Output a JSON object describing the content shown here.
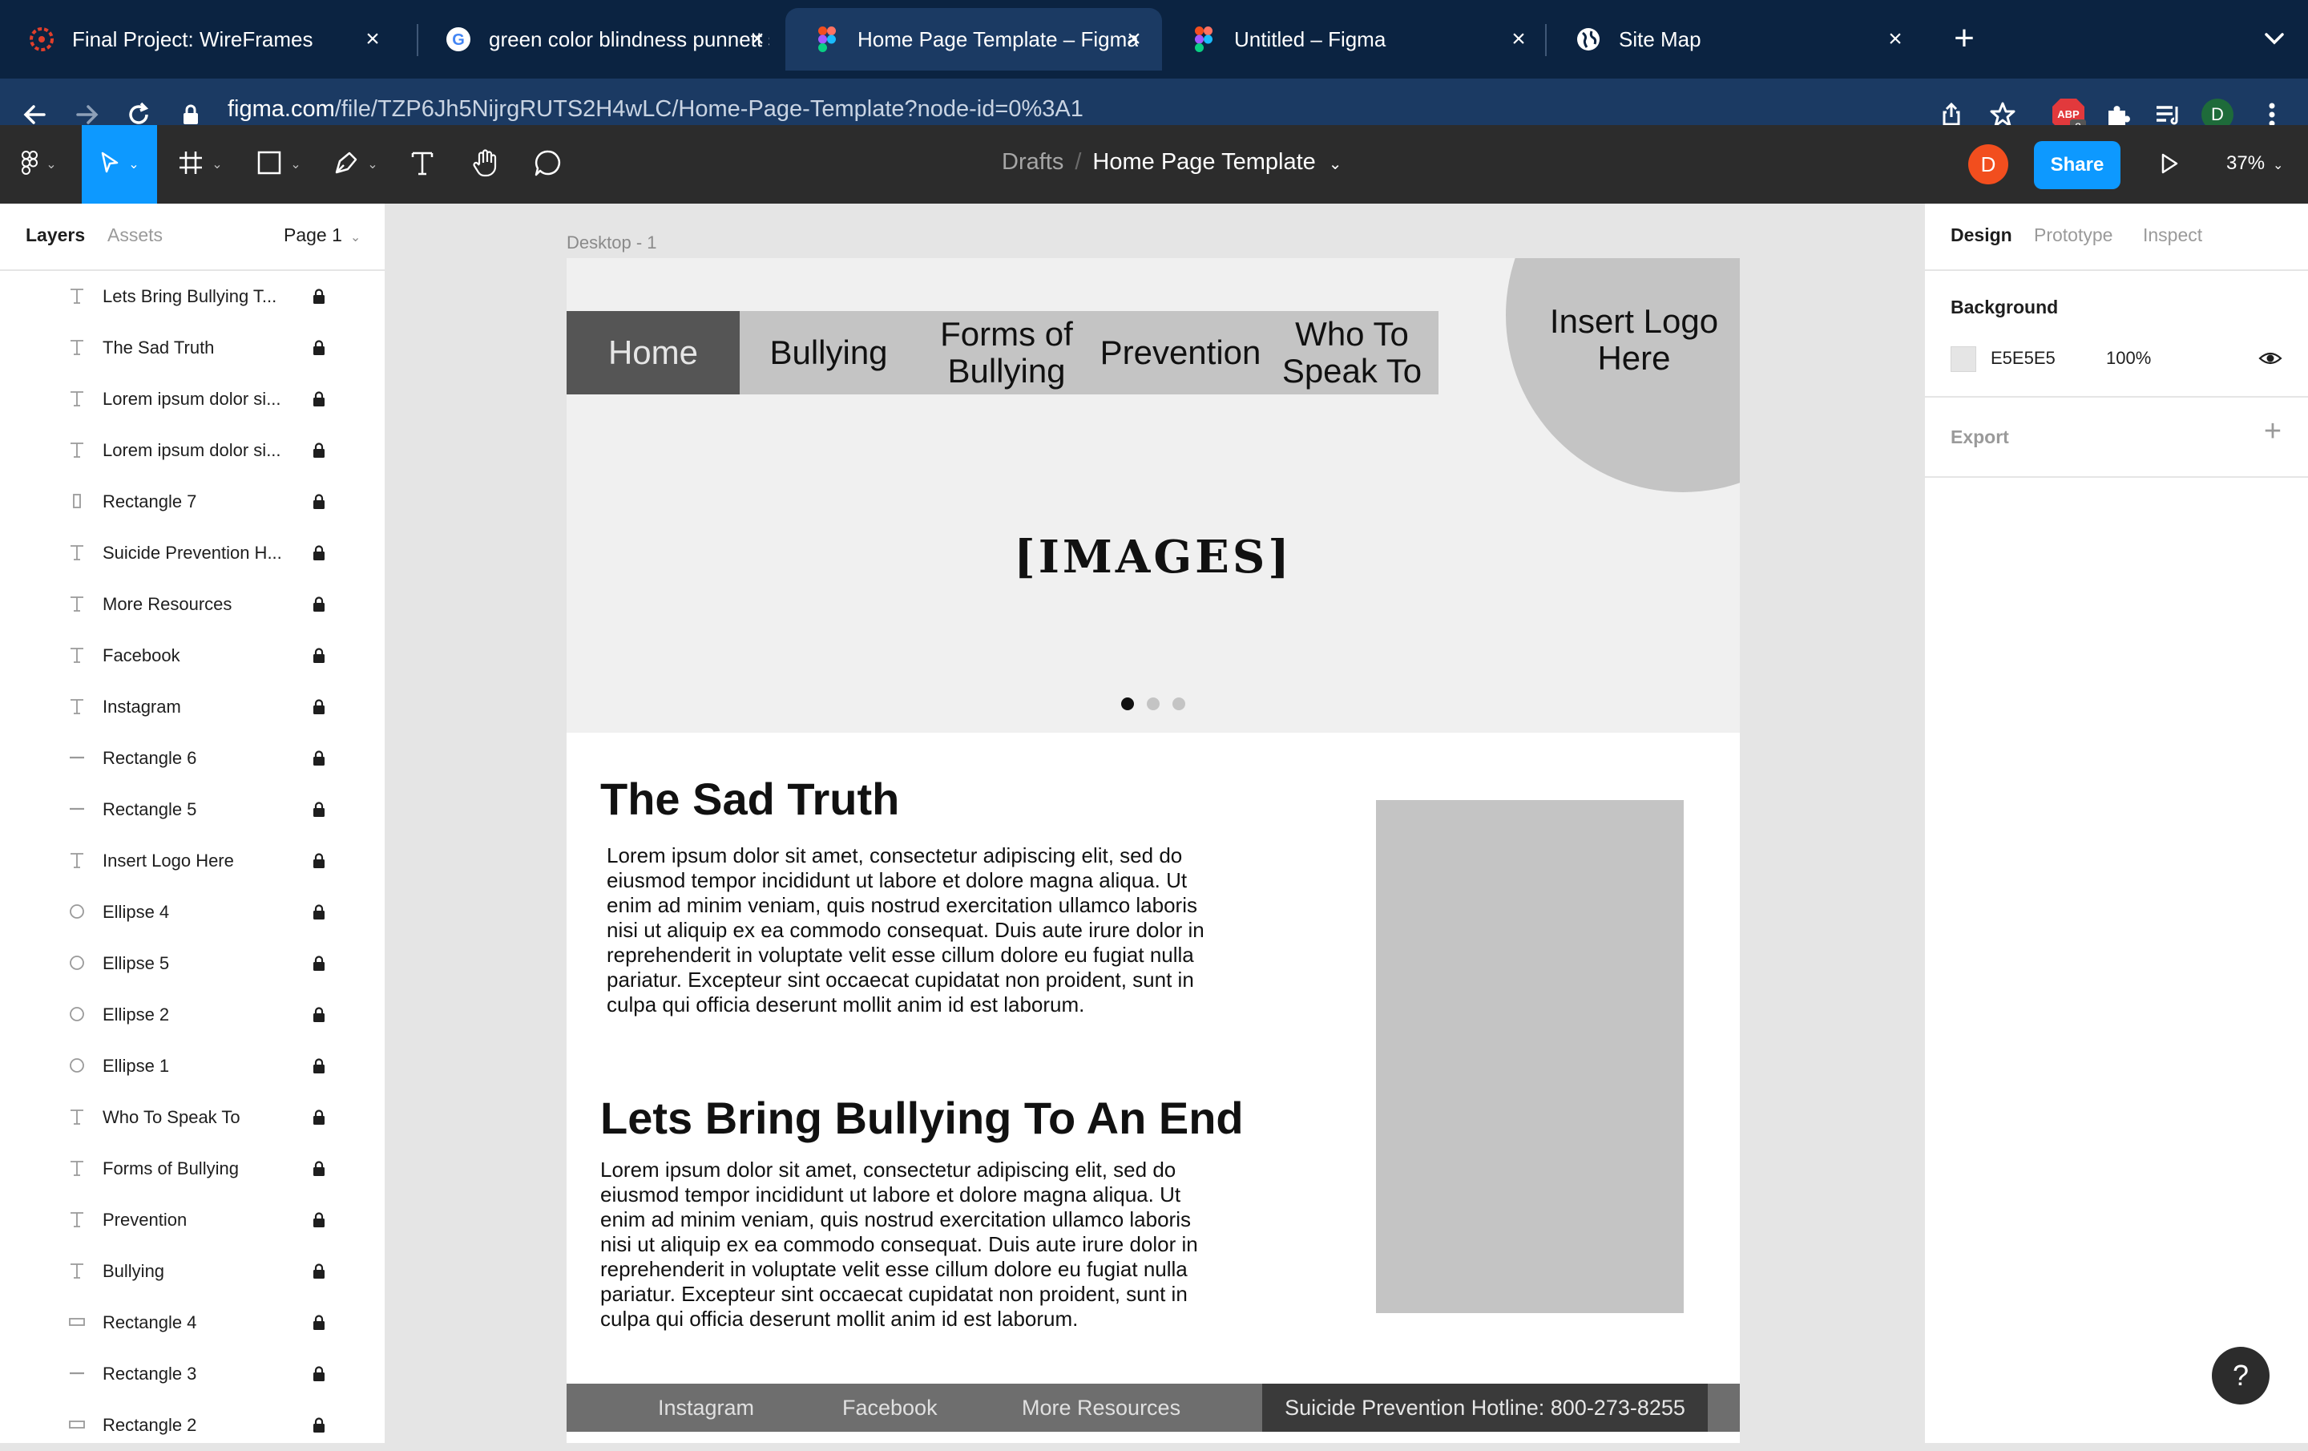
{
  "browser": {
    "tabs": [
      {
        "title": "Final Project: WireFrames",
        "icon": "canvas-icon"
      },
      {
        "title": "green color blindness punnett s",
        "icon": "google-icon"
      },
      {
        "title": "Home Page Template – Figma",
        "icon": "figma-icon",
        "active": true
      },
      {
        "title": "Untitled – Figma",
        "icon": "figma-icon"
      },
      {
        "title": "Site Map",
        "icon": "globe-icon"
      }
    ],
    "url_host": "figma.com",
    "url_path": "/file/TZP6Jh5NijrgRUTS2H4wLC/Home-Page-Template?node-id=0%3A1",
    "abp_badge": "ABP",
    "abp_count": "2",
    "profile_initial": "D"
  },
  "figma": {
    "breadcrumb_parent": "Drafts",
    "breadcrumb_sep": "/",
    "file_name": "Home Page Template",
    "user_initial": "D",
    "share_label": "Share",
    "zoom": "37%"
  },
  "left_panel": {
    "tab_layers": "Layers",
    "tab_assets": "Assets",
    "page": "Page 1",
    "layers": [
      {
        "name": "Lets Bring Bullying T...",
        "type": "text"
      },
      {
        "name": "The Sad Truth",
        "type": "text"
      },
      {
        "name": "Lorem ipsum dolor si...",
        "type": "text"
      },
      {
        "name": "Lorem ipsum dolor si...",
        "type": "text"
      },
      {
        "name": "Rectangle 7",
        "type": "rect-tall"
      },
      {
        "name": "Suicide Prevention H...",
        "type": "text"
      },
      {
        "name": "More Resources",
        "type": "text"
      },
      {
        "name": "Facebook",
        "type": "text"
      },
      {
        "name": "Instagram",
        "type": "text"
      },
      {
        "name": "Rectangle 6",
        "type": "line"
      },
      {
        "name": "Rectangle 5",
        "type": "line"
      },
      {
        "name": "Insert Logo Here",
        "type": "text"
      },
      {
        "name": "Ellipse 4",
        "type": "ellipse"
      },
      {
        "name": "Ellipse 5",
        "type": "ellipse"
      },
      {
        "name": "Ellipse 2",
        "type": "ellipse"
      },
      {
        "name": "Ellipse 1",
        "type": "ellipse"
      },
      {
        "name": "Who To Speak To",
        "type": "text"
      },
      {
        "name": "Forms of Bullying",
        "type": "text"
      },
      {
        "name": "Prevention",
        "type": "text"
      },
      {
        "name": "Bullying",
        "type": "text"
      },
      {
        "name": "Rectangle 4",
        "type": "rect-wide"
      },
      {
        "name": "Rectangle 3",
        "type": "line"
      },
      {
        "name": "Rectangle 2",
        "type": "rect-wide"
      }
    ]
  },
  "canvas": {
    "frame_label": "Desktop - 1",
    "nav": [
      {
        "label": "Home"
      },
      {
        "label": "Bullying"
      },
      {
        "label": "Forms of\nBullying"
      },
      {
        "label": "Prevention"
      },
      {
        "label": "Who To\nSpeak To"
      }
    ],
    "logo_text": "Insert Logo\nHere",
    "images_placeholder": "[IMAGES]",
    "heading_1": "The Sad Truth",
    "paragraph_1": "Lorem ipsum dolor sit amet, consectetur adipiscing elit, sed do eiusmod tempor incididunt ut labore et dolore magna aliqua. Ut enim ad minim veniam, quis nostrud exercitation ullamco laboris nisi ut aliquip ex ea commodo consequat. Duis aute irure dolor in reprehenderit in voluptate velit esse cillum dolore eu fugiat nulla pariatur. Excepteur sint occaecat cupidatat non proident, sunt in culpa qui officia deserunt mollit anim id est laborum.",
    "heading_2": "Lets Bring Bullying To An End",
    "paragraph_2": "Lorem ipsum dolor sit amet, consectetur adipiscing elit, sed do eiusmod tempor incididunt ut labore et dolore magna aliqua. Ut enim ad minim veniam, quis nostrud exercitation ullamco laboris nisi ut aliquip ex ea commodo consequat. Duis aute irure dolor in reprehenderit in voluptate velit esse cillum dolore eu fugiat nulla pariatur. Excepteur sint occaecat cupidatat non proident, sunt in culpa qui officia deserunt mollit anim id est laborum.",
    "footer": {
      "instagram": "Instagram",
      "facebook": "Facebook",
      "more_resources": "More Resources",
      "hotline": "Suicide Prevention Hotline:  800-273-8255"
    }
  },
  "right_panel": {
    "tab_design": "Design",
    "tab_prototype": "Prototype",
    "tab_inspect": "Inspect",
    "background_title": "Background",
    "background_hex": "E5E5E5",
    "background_opacity": "100%",
    "export_title": "Export"
  },
  "help_label": "?",
  "colors": {
    "figma_blue": "#0d99ff",
    "toolbar_dark": "#2c2c2c",
    "browser_tabbar": "#0b2341",
    "browser_active_tab": "#1b3a63",
    "canvas_bg": "#e5e5e5",
    "placeholder_gray": "#c4c4c4",
    "nav_home": "#555555"
  }
}
